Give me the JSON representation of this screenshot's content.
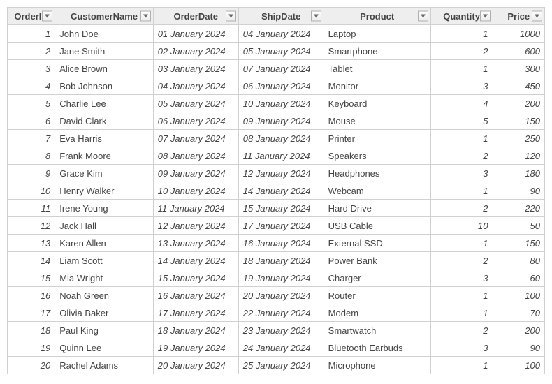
{
  "columns": [
    {
      "key": "OrderID",
      "label": "OrderID",
      "type": "num"
    },
    {
      "key": "CustomerName",
      "label": "CustomerName",
      "type": "txt"
    },
    {
      "key": "OrderDate",
      "label": "OrderDate",
      "type": "date"
    },
    {
      "key": "ShipDate",
      "label": "ShipDate",
      "type": "date"
    },
    {
      "key": "Product",
      "label": "Product",
      "type": "txt"
    },
    {
      "key": "Quantity",
      "label": "Quantity",
      "type": "num"
    },
    {
      "key": "Price",
      "label": "Price",
      "type": "num"
    }
  ],
  "rows": [
    {
      "OrderID": 1,
      "CustomerName": "John Doe",
      "OrderDate": "01 January 2024",
      "ShipDate": "04 January 2024",
      "Product": "Laptop",
      "Quantity": 1,
      "Price": 1000
    },
    {
      "OrderID": 2,
      "CustomerName": "Jane Smith",
      "OrderDate": "02 January 2024",
      "ShipDate": "05 January 2024",
      "Product": "Smartphone",
      "Quantity": 2,
      "Price": 600
    },
    {
      "OrderID": 3,
      "CustomerName": "Alice Brown",
      "OrderDate": "03 January 2024",
      "ShipDate": "07 January 2024",
      "Product": "Tablet",
      "Quantity": 1,
      "Price": 300
    },
    {
      "OrderID": 4,
      "CustomerName": "Bob Johnson",
      "OrderDate": "04 January 2024",
      "ShipDate": "06 January 2024",
      "Product": "Monitor",
      "Quantity": 3,
      "Price": 450
    },
    {
      "OrderID": 5,
      "CustomerName": "Charlie Lee",
      "OrderDate": "05 January 2024",
      "ShipDate": "10 January 2024",
      "Product": "Keyboard",
      "Quantity": 4,
      "Price": 200
    },
    {
      "OrderID": 6,
      "CustomerName": "David Clark",
      "OrderDate": "06 January 2024",
      "ShipDate": "09 January 2024",
      "Product": "Mouse",
      "Quantity": 5,
      "Price": 150
    },
    {
      "OrderID": 7,
      "CustomerName": "Eva Harris",
      "OrderDate": "07 January 2024",
      "ShipDate": "08 January 2024",
      "Product": "Printer",
      "Quantity": 1,
      "Price": 250
    },
    {
      "OrderID": 8,
      "CustomerName": "Frank Moore",
      "OrderDate": "08 January 2024",
      "ShipDate": "11 January 2024",
      "Product": "Speakers",
      "Quantity": 2,
      "Price": 120
    },
    {
      "OrderID": 9,
      "CustomerName": "Grace Kim",
      "OrderDate": "09 January 2024",
      "ShipDate": "12 January 2024",
      "Product": "Headphones",
      "Quantity": 3,
      "Price": 180
    },
    {
      "OrderID": 10,
      "CustomerName": "Henry Walker",
      "OrderDate": "10 January 2024",
      "ShipDate": "14 January 2024",
      "Product": "Webcam",
      "Quantity": 1,
      "Price": 90
    },
    {
      "OrderID": 11,
      "CustomerName": "Irene Young",
      "OrderDate": "11 January 2024",
      "ShipDate": "15 January 2024",
      "Product": "Hard Drive",
      "Quantity": 2,
      "Price": 220
    },
    {
      "OrderID": 12,
      "CustomerName": "Jack Hall",
      "OrderDate": "12 January 2024",
      "ShipDate": "17 January 2024",
      "Product": "USB Cable",
      "Quantity": 10,
      "Price": 50
    },
    {
      "OrderID": 13,
      "CustomerName": "Karen Allen",
      "OrderDate": "13 January 2024",
      "ShipDate": "16 January 2024",
      "Product": "External SSD",
      "Quantity": 1,
      "Price": 150
    },
    {
      "OrderID": 14,
      "CustomerName": "Liam Scott",
      "OrderDate": "14 January 2024",
      "ShipDate": "18 January 2024",
      "Product": "Power Bank",
      "Quantity": 2,
      "Price": 80
    },
    {
      "OrderID": 15,
      "CustomerName": "Mia Wright",
      "OrderDate": "15 January 2024",
      "ShipDate": "19 January 2024",
      "Product": "Charger",
      "Quantity": 3,
      "Price": 60
    },
    {
      "OrderID": 16,
      "CustomerName": "Noah Green",
      "OrderDate": "16 January 2024",
      "ShipDate": "20 January 2024",
      "Product": "Router",
      "Quantity": 1,
      "Price": 100
    },
    {
      "OrderID": 17,
      "CustomerName": "Olivia Baker",
      "OrderDate": "17 January 2024",
      "ShipDate": "22 January 2024",
      "Product": "Modem",
      "Quantity": 1,
      "Price": 70
    },
    {
      "OrderID": 18,
      "CustomerName": "Paul King",
      "OrderDate": "18 January 2024",
      "ShipDate": "23 January 2024",
      "Product": "Smartwatch",
      "Quantity": 2,
      "Price": 200
    },
    {
      "OrderID": 19,
      "CustomerName": "Quinn Lee",
      "OrderDate": "19 January 2024",
      "ShipDate": "24 January 2024",
      "Product": "Bluetooth Earbuds",
      "Quantity": 3,
      "Price": 90
    },
    {
      "OrderID": 20,
      "CustomerName": "Rachel Adams",
      "OrderDate": "20 January 2024",
      "ShipDate": "25 January 2024",
      "Product": "Microphone",
      "Quantity": 1,
      "Price": 100
    }
  ]
}
